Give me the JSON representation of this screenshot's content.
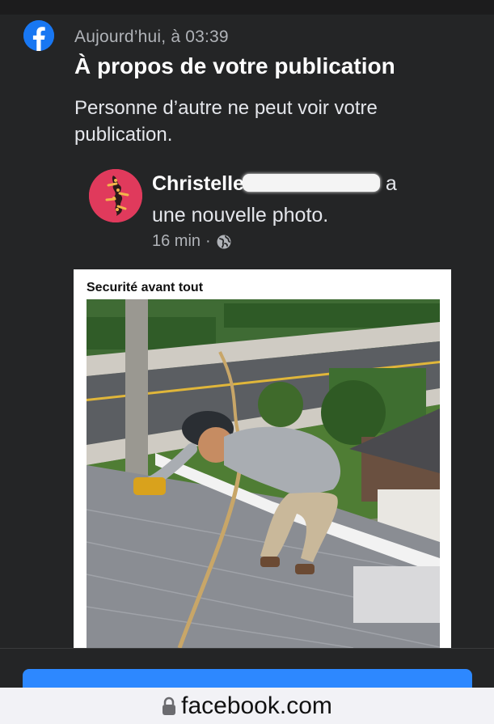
{
  "notification": {
    "time": "Aujourd’hui, à 03:39",
    "title": "À propos de votre publication",
    "message": "Personne d’autre ne peut voir votre publication."
  },
  "post": {
    "author_first": "Christelle",
    "author_rest_suffix": "a",
    "action": "une nouvelle photo.",
    "time_ago": "16 min",
    "separator": "·",
    "privacy_icon": "globe-icon",
    "photo_caption": "Securité avant tout"
  },
  "browser": {
    "url": "facebook.com",
    "secure_icon": "lock-icon"
  },
  "colors": {
    "background": "#242526",
    "brand": "#1877f2",
    "button": "#2d88ff",
    "url_bar": "#f2f2f6"
  }
}
